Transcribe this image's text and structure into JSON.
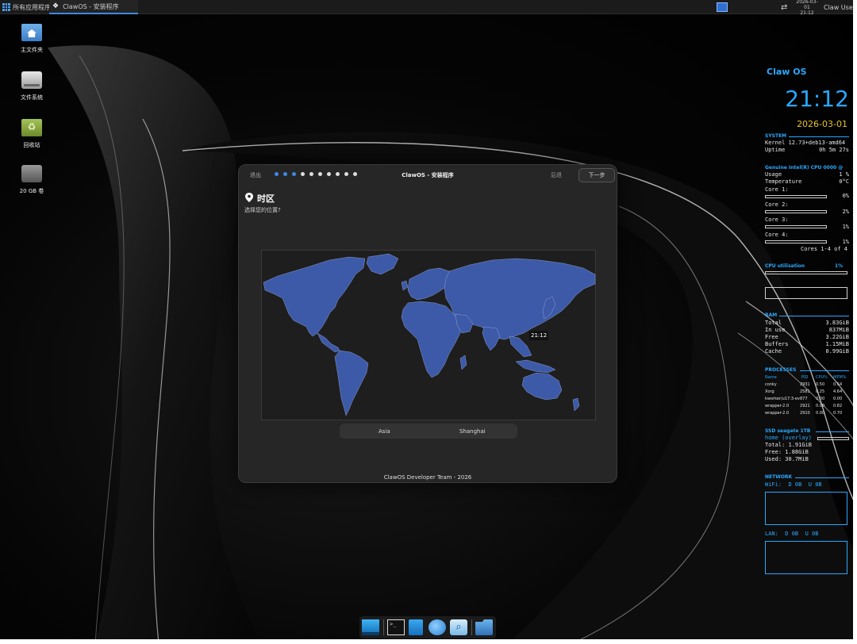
{
  "top_panel": {
    "apps_menu_label": "所有应用程序",
    "task_label": "ClawOS - 安装程序",
    "clock_date": "2026-03-01",
    "clock_time": "21:12",
    "user_name": "Claw User"
  },
  "desktop_icons": [
    {
      "label": "主文件夹",
      "icon": "home-folder-icon"
    },
    {
      "label": "文件系统",
      "icon": "drive-icon"
    },
    {
      "label": "回收站",
      "icon": "trash-icon"
    },
    {
      "label": "20 GB 卷",
      "icon": "volume-icon"
    }
  ],
  "installer": {
    "quit_label": "退出",
    "title": "ClawOS - 安装程序",
    "back_label": "后退",
    "next_label": "下一步",
    "steps_total": 10,
    "steps_done": 3,
    "page_title": "时区",
    "page_subtitle": "选择您的位置?",
    "map_time": "21:12",
    "region": "Asia",
    "city": "Shanghai",
    "credit": "ClawOS Developer Team - 2026",
    "map_color": "#3d5aa8"
  },
  "conky": {
    "os_name": "Claw OS",
    "time": "21:12",
    "date": "2026-03-01",
    "system_head": "SYSTEM",
    "kernel": "Kernel 12.73+deb13-amd64",
    "uptime_label": "Uptime",
    "uptime_value": "0h 5m 27s",
    "cpu_head": "Genuine Intel(R) CPU 0000 @",
    "usage_label": "Usage",
    "usage_value": "1 %",
    "temp_label": "Temperature",
    "temp_value": "0°C",
    "cores": [
      {
        "label": "Core 1:",
        "value": "0%"
      },
      {
        "label": "Core 2:",
        "value": "2%"
      },
      {
        "label": "Core 3:",
        "value": "1%"
      },
      {
        "label": "Core 4:",
        "value": "1%"
      }
    ],
    "cores_summary": "Cores 1-4 of 4",
    "cpu_util_label": "CPU utilisation",
    "cpu_util_value": "1%",
    "ram_head": "RAM",
    "ram": [
      {
        "label": "Total",
        "value": "3.83GiB"
      },
      {
        "label": "In use",
        "value": "837MiB"
      },
      {
        "label": "Free",
        "value": "3.22GiB"
      },
      {
        "label": "Buffers",
        "value": "1.15MiB"
      },
      {
        "label": "Cache",
        "value": "0.99GiB"
      }
    ],
    "proc_head": "PROCESSES",
    "proc_cols": [
      "Name",
      "PID",
      "CPU%",
      "MEM%"
    ],
    "procs": [
      [
        "conky",
        "2931",
        "0.50",
        "0.54"
      ],
      [
        "Xorg",
        "2581",
        "0.25",
        "4.64"
      ],
      [
        "kworker/u17:3-ev",
        "877",
        "0.00",
        "0.00"
      ],
      [
        "wrapper-2.0",
        "2921",
        "0.00",
        "0.82"
      ],
      [
        "wrapper-2.0",
        "2910",
        "0.00",
        "0.70"
      ]
    ],
    "ssd_head": "SSD seagate 1TB",
    "ssd_mount": "home (overlay)",
    "ssd_total": "Total: 1.91GiB",
    "ssd_free": "Free: 1.88GiB",
    "ssd_used": "Used: 30.7MiB",
    "net_head": "NETWORK",
    "wifi": "WiFi:  D 0B  U 0B",
    "lan": "LAN:  D 0B  U 0B"
  },
  "dock": {
    "items": [
      "desktop-icon",
      "terminal-icon",
      "file-manager-icon",
      "browser-icon",
      "search-icon",
      "folder-icon"
    ]
  }
}
